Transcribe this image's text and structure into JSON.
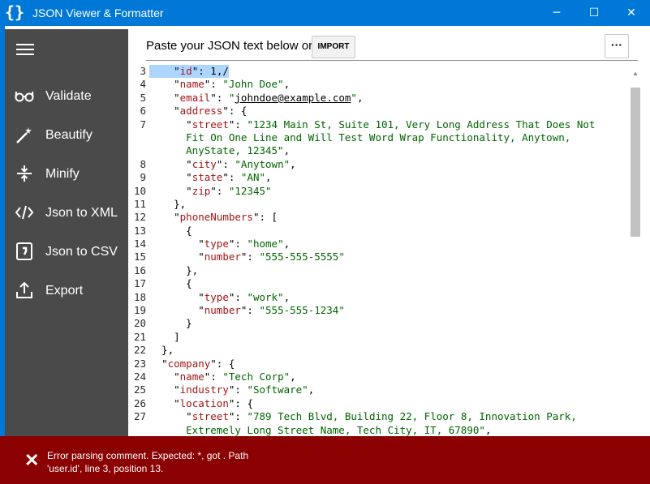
{
  "window": {
    "title": "JSON Viewer & Formatter",
    "app_icon": "{}",
    "minimize": "─",
    "maximize": "☐",
    "close": "✕"
  },
  "sidebar": {
    "items": [
      {
        "label": "Validate",
        "icon": "glasses-icon"
      },
      {
        "label": "Beautify",
        "icon": "magic-wand-icon"
      },
      {
        "label": "Minify",
        "icon": "compress-icon"
      },
      {
        "label": "Json to XML",
        "icon": "code-icon"
      },
      {
        "label": "Json to CSV",
        "icon": "csv-file-icon"
      },
      {
        "label": "Export",
        "icon": "export-icon"
      }
    ]
  },
  "toolbar": {
    "prompt": "Paste your JSON text below or",
    "import_label": "IMPORT",
    "more_label": "···"
  },
  "editor": {
    "lines": [
      {
        "n": "3",
        "t": "    \"id\": 1,/"
      },
      {
        "n": "4",
        "t": "    \"name\": \"John Doe\","
      },
      {
        "n": "5",
        "t": "    \"email\": \"johndoe@example.com\","
      },
      {
        "n": "6",
        "t": "    \"address\": {"
      },
      {
        "n": "7",
        "t": "      \"street\": \"1234 Main St, Suite 101, Very Long Address That Does Not"
      },
      {
        "n": "",
        "t": "      Fit On One Line and Will Test Word Wrap Functionality, Anytown,"
      },
      {
        "n": "",
        "t": "      AnyState, 12345\","
      },
      {
        "n": "8",
        "t": "      \"city\": \"Anytown\","
      },
      {
        "n": "9",
        "t": "      \"state\": \"AN\","
      },
      {
        "n": "10",
        "t": "      \"zip\": \"12345\""
      },
      {
        "n": "11",
        "t": "    },"
      },
      {
        "n": "12",
        "t": "    \"phoneNumbers\": ["
      },
      {
        "n": "13",
        "t": "      {"
      },
      {
        "n": "14",
        "t": "        \"type\": \"home\","
      },
      {
        "n": "15",
        "t": "        \"number\": \"555-555-5555\""
      },
      {
        "n": "16",
        "t": "      },"
      },
      {
        "n": "17",
        "t": "      {"
      },
      {
        "n": "18",
        "t": "        \"type\": \"work\","
      },
      {
        "n": "19",
        "t": "        \"number\": \"555-555-1234\""
      },
      {
        "n": "20",
        "t": "      }"
      },
      {
        "n": "21",
        "t": "    ]"
      },
      {
        "n": "22",
        "t": "  },"
      },
      {
        "n": "23",
        "t": "  \"company\": {"
      },
      {
        "n": "24",
        "t": "    \"name\": \"Tech Corp\","
      },
      {
        "n": "25",
        "t": "    \"industry\": \"Software\","
      },
      {
        "n": "26",
        "t": "    \"location\": {"
      },
      {
        "n": "27",
        "t": "      \"street\": \"789 Tech Blvd, Building 22, Floor 8, Innovation Park,"
      },
      {
        "n": "",
        "t": "      Extremely Long Street Name, Tech City, IT, 67890\","
      }
    ]
  },
  "error": {
    "icon": "✕",
    "message": "Error parsing comment. Expected: *, got . Path 'user.id', line 3, position 13."
  },
  "colors": {
    "titlebar": "#0078d7",
    "sidebar": "#4a4a4a",
    "error": "#8b0000",
    "key": "#a31515",
    "string": "#006400",
    "selection": "#add6ff"
  }
}
